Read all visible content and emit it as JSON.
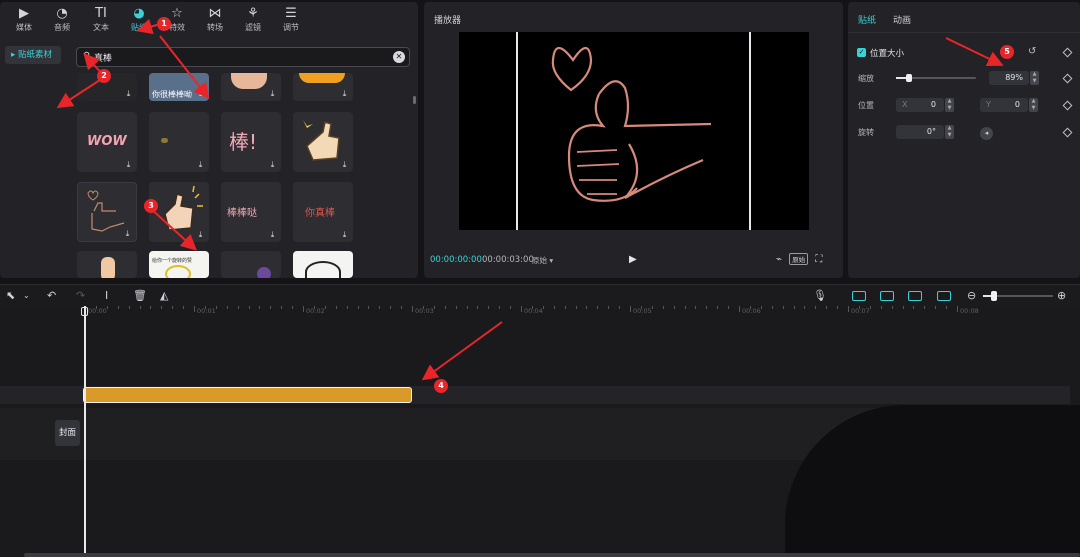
{
  "toolbar": {
    "tabs": [
      {
        "label": "媒体",
        "icon": "media-icon"
      },
      {
        "label": "音频",
        "icon": "audio-icon"
      },
      {
        "label": "文本",
        "icon": "text-icon"
      },
      {
        "label": "贴纸",
        "icon": "sticker-icon",
        "active": true
      },
      {
        "label": "特效",
        "icon": "effects-icon"
      },
      {
        "label": "转场",
        "icon": "transition-icon"
      },
      {
        "label": "滤镜",
        "icon": "filter-icon"
      },
      {
        "label": "调节",
        "icon": "adjust-icon"
      }
    ]
  },
  "media": {
    "sidebar_item": "▸ 贴纸素材",
    "search_value": "真棒",
    "tiles": [
      {
        "text": "你很棒棒呦"
      },
      {
        "text": "WOW"
      },
      {
        "text": "棒!"
      },
      {
        "text": "棒棒哒"
      },
      {
        "text": "你真棒"
      },
      {
        "text": "给你一个旋转的赞"
      }
    ]
  },
  "player": {
    "title": "播放器",
    "time_current": "00:00:00:00",
    "time_total": "00:00:03:00",
    "ratio": "原始 ▾",
    "original_label": "原始"
  },
  "properties": {
    "tab_sticker": "贴纸",
    "tab_animation": "动画",
    "size_section": "位置大小",
    "scale_label": "缩放",
    "scale_value": "89%",
    "scale_level_percent": 89,
    "position_label": "位置",
    "x_prefix": "X",
    "x_value": "0",
    "y_prefix": "Y",
    "y_value": "0",
    "rotation_label": "旋转",
    "rotation_value": "0°"
  },
  "timeline": {
    "ruler_labels": [
      "00:00",
      "00:01",
      "00:02",
      "00:03",
      "00:04",
      "00:05",
      "00:06",
      "00:07",
      "00:08"
    ],
    "cover_label": "封面"
  },
  "annotations": [
    "1",
    "2",
    "3",
    "4",
    "5"
  ],
  "colors": {
    "accent": "#3ad1d8",
    "clip": "#d99a2a",
    "annotation": "#e8262a"
  }
}
